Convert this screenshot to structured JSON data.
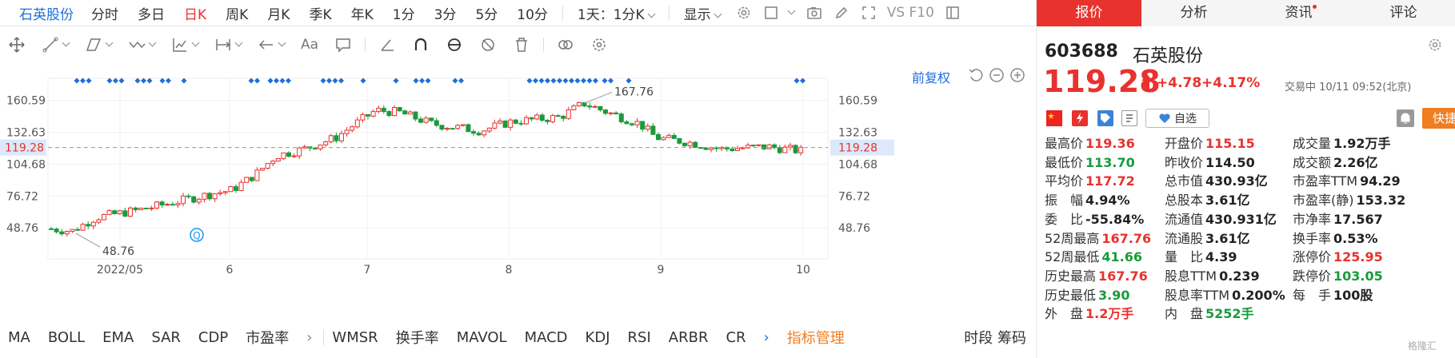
{
  "toolbar": {
    "stock_name": "石英股份",
    "periods": [
      "分时",
      "多日",
      "日K",
      "周K",
      "月K",
      "季K",
      "年K",
      "1分",
      "3分",
      "5分",
      "10分"
    ],
    "active_period": "日K",
    "timeframe_select": "1天：1分K",
    "display_select": "显示",
    "vs_label": "VS F10"
  },
  "chart_top": {
    "adjust_label": "前复权"
  },
  "chart_data": {
    "type": "candlestick",
    "y_ticks": [
      160.59,
      132.63,
      104.68,
      76.72,
      48.76
    ],
    "ylim": [
      30,
      180
    ],
    "x_ticks": [
      "2022/05",
      "6",
      "7",
      "8",
      "9",
      "10"
    ],
    "current_price": 119.28,
    "high_annotation": 167.76,
    "low_annotation": 48.76
  },
  "indicators": [
    "MA",
    "BOLL",
    "EMA",
    "SAR",
    "CDP",
    "市盈率",
    "WMSR",
    "换手率",
    "MAVOL",
    "MACD",
    "KDJ",
    "RSI",
    "ARBR",
    "CR"
  ],
  "indicator_manage": "指标管理",
  "bottom_right": "时段 筹码",
  "panel": {
    "tabs": [
      "报价",
      "分析",
      "资讯",
      "评论"
    ],
    "code": "603688",
    "name": "石英股份",
    "price": "119.28",
    "change": "+4.78",
    "change_pct": "+4.17%",
    "status": "交易中 10/11 09:52(北京)",
    "watch_label": "自选",
    "trade_label": "快捷交易",
    "stats": [
      [
        {
          "k": "最高价",
          "v": "119.36",
          "c": "red"
        },
        {
          "k": "开盘价",
          "v": "115.15",
          "c": "red"
        },
        {
          "k": "成交量",
          "v": "1.92万手",
          "c": "blk"
        }
      ],
      [
        {
          "k": "最低价",
          "v": "113.70",
          "c": "green"
        },
        {
          "k": "昨收价",
          "v": "114.50",
          "c": "blk"
        },
        {
          "k": "成交额",
          "v": "2.26亿",
          "c": "blk"
        }
      ],
      [
        {
          "k": "平均价",
          "v": "117.72",
          "c": "red"
        },
        {
          "k": "总市值",
          "v": "430.93亿",
          "c": "blk"
        },
        {
          "k": "市盈率TTM",
          "v": "94.29",
          "c": "blk"
        }
      ],
      [
        {
          "k": "振　幅",
          "v": "4.94%",
          "c": "blk"
        },
        {
          "k": "总股本",
          "v": "3.61亿",
          "c": "blk"
        },
        {
          "k": "市盈率(静)",
          "v": "153.32",
          "c": "blk"
        }
      ],
      [
        {
          "k": "委　比",
          "v": "-55.84%",
          "c": "blk"
        },
        {
          "k": "流通值",
          "v": "430.931亿",
          "c": "blk"
        },
        {
          "k": "市净率",
          "v": "17.567",
          "c": "blk"
        }
      ],
      [
        {
          "k": "52周最高",
          "v": "167.76",
          "c": "red"
        },
        {
          "k": "流通股",
          "v": "3.61亿",
          "c": "blk"
        },
        {
          "k": "换手率",
          "v": "0.53%",
          "c": "blk"
        }
      ],
      [
        {
          "k": "52周最低",
          "v": "41.66",
          "c": "green"
        },
        {
          "k": "量　比",
          "v": "4.39",
          "c": "blk"
        },
        {
          "k": "涨停价",
          "v": "125.95",
          "c": "red"
        }
      ],
      [
        {
          "k": "历史最高",
          "v": "167.76",
          "c": "red"
        },
        {
          "k": "股息TTM",
          "v": "0.239",
          "c": "blk"
        },
        {
          "k": "跌停价",
          "v": "103.05",
          "c": "green"
        }
      ],
      [
        {
          "k": "历史最低",
          "v": "3.90",
          "c": "green"
        },
        {
          "k": "股息率TTM",
          "v": "0.200%",
          "c": "blk"
        },
        {
          "k": "每　手",
          "v": "100股",
          "c": "blk"
        }
      ],
      [
        {
          "k": "外　盘",
          "v": "1.2万手",
          "c": "red"
        },
        {
          "k": "内　盘",
          "v": "5252手",
          "c": "green"
        }
      ]
    ],
    "watermark": "格隆汇"
  },
  "colors": {
    "up": "#e8322e",
    "down": "#1a9a3c",
    "accent": "#1e6fd9",
    "orange": "#f07d20"
  }
}
